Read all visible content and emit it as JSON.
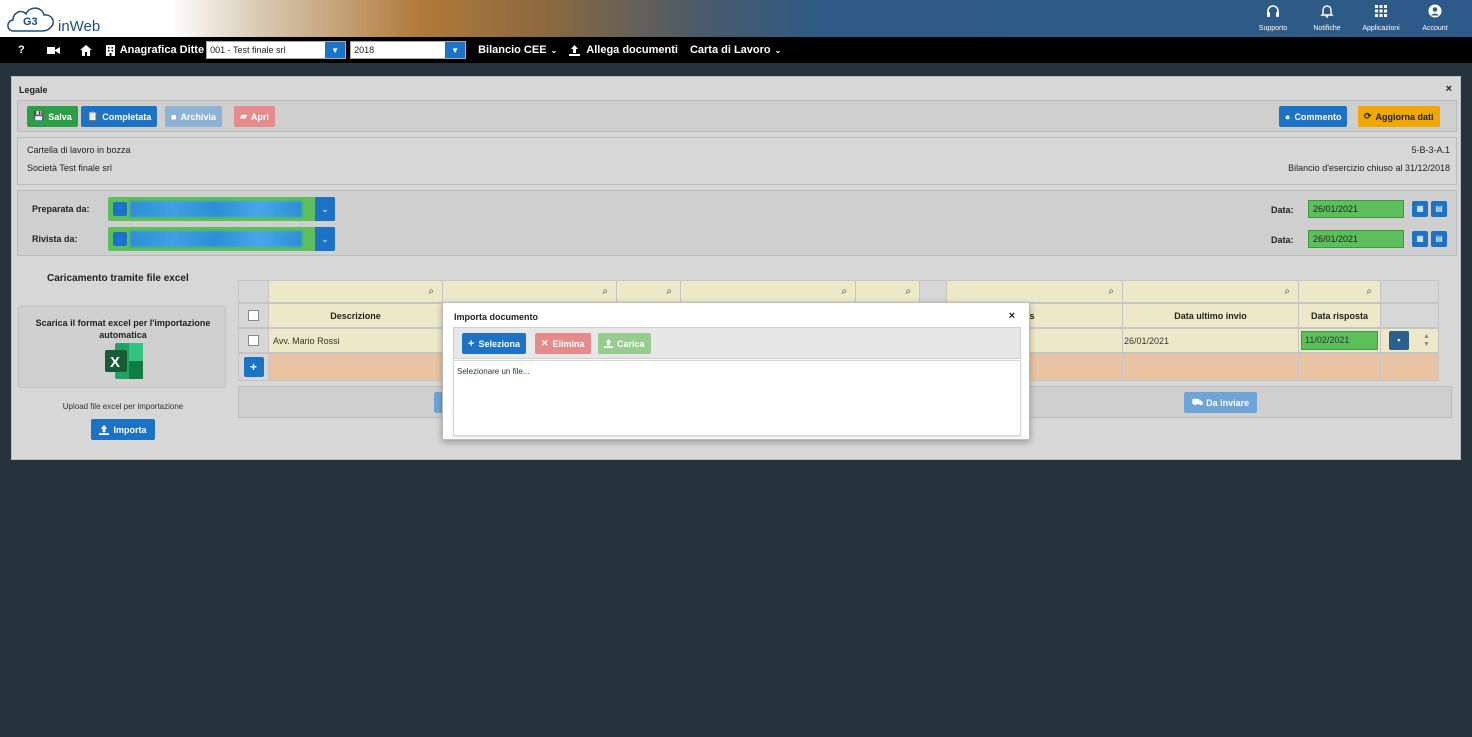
{
  "topbar": {
    "logo_text": "inWeb",
    "icons": [
      {
        "name": "headset-icon",
        "glyph": "🎧",
        "label": "Supporto"
      },
      {
        "name": "bell-icon",
        "glyph": "🔔",
        "label": "Notifiche"
      },
      {
        "name": "apps-grid-icon",
        "glyph": "▦",
        "label": "Applicazioni"
      },
      {
        "name": "account-icon",
        "glyph": "●",
        "label": "Account"
      }
    ]
  },
  "navbar": {
    "help": "?",
    "anagrafica": "Anagrafica Ditte",
    "company_select": "001 - Test finale srl",
    "year_select": "2018",
    "bilancio": "Bilancio CEE",
    "allega": "Allega documenti",
    "carta": "Carta di Lavoro"
  },
  "panel": {
    "title": "Legale",
    "close": "×",
    "buttons": {
      "salva": "Salva",
      "completata": "Completata",
      "archivia": "Archivia",
      "apri": "Apri",
      "commento": "Commento",
      "aggiorna": "Aggiorna dati"
    },
    "info": {
      "status": "Cartella di lavoro in bozza",
      "company": "Società Test finale srl",
      "code": "5-B-3-A.1",
      "bilancio": "Bilancio d'esercizio chiuso al 31/12/2018"
    },
    "preparata_label": "Preparata da:",
    "rivista_label": "Rivista da:",
    "data_label": "Data:",
    "preparata_date": "26/01/2021",
    "rivista_date": "26/01/2021"
  },
  "excel": {
    "title": "Caricamento tramite file excel",
    "download_text": "Scarica il format excel per l'importazione automatica",
    "upload_label": "Upload file excel per importazione",
    "importa": "Importa"
  },
  "grid": {
    "headers": {
      "descrizione": "Descrizione",
      "status": "Status",
      "data_ultimo_invio": "Data ultimo invio",
      "data_risposta": "Data risposta"
    },
    "row": {
      "descrizione": "Avv. Mario Rossi",
      "data_ultimo_invio": "26/01/2021",
      "data_risposta": "11/02/2021"
    },
    "add": "+",
    "da_inviare": "Da inviare"
  },
  "modal": {
    "title": "Importa documento",
    "close": "×",
    "seleziona": "Seleziona",
    "elimina": "Elimina",
    "carica": "Carica",
    "placeholder": "Selezionare un file..."
  }
}
